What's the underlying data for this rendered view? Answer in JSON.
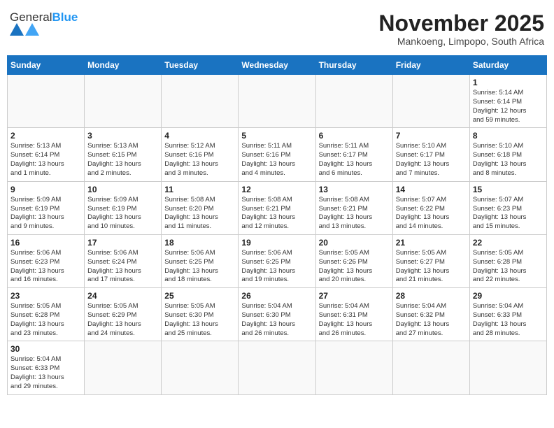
{
  "header": {
    "logo_general": "General",
    "logo_blue": "Blue",
    "month_title": "November 2025",
    "location": "Mankoeng, Limpopo, South Africa"
  },
  "weekdays": [
    "Sunday",
    "Monday",
    "Tuesday",
    "Wednesday",
    "Thursday",
    "Friday",
    "Saturday"
  ],
  "weeks": [
    [
      {
        "day": "",
        "info": ""
      },
      {
        "day": "",
        "info": ""
      },
      {
        "day": "",
        "info": ""
      },
      {
        "day": "",
        "info": ""
      },
      {
        "day": "",
        "info": ""
      },
      {
        "day": "",
        "info": ""
      },
      {
        "day": "1",
        "info": "Sunrise: 5:14 AM\nSunset: 6:14 PM\nDaylight: 12 hours\nand 59 minutes."
      }
    ],
    [
      {
        "day": "2",
        "info": "Sunrise: 5:13 AM\nSunset: 6:14 PM\nDaylight: 13 hours\nand 1 minute."
      },
      {
        "day": "3",
        "info": "Sunrise: 5:13 AM\nSunset: 6:15 PM\nDaylight: 13 hours\nand 2 minutes."
      },
      {
        "day": "4",
        "info": "Sunrise: 5:12 AM\nSunset: 6:16 PM\nDaylight: 13 hours\nand 3 minutes."
      },
      {
        "day": "5",
        "info": "Sunrise: 5:11 AM\nSunset: 6:16 PM\nDaylight: 13 hours\nand 4 minutes."
      },
      {
        "day": "6",
        "info": "Sunrise: 5:11 AM\nSunset: 6:17 PM\nDaylight: 13 hours\nand 6 minutes."
      },
      {
        "day": "7",
        "info": "Sunrise: 5:10 AM\nSunset: 6:17 PM\nDaylight: 13 hours\nand 7 minutes."
      },
      {
        "day": "8",
        "info": "Sunrise: 5:10 AM\nSunset: 6:18 PM\nDaylight: 13 hours\nand 8 minutes."
      }
    ],
    [
      {
        "day": "9",
        "info": "Sunrise: 5:09 AM\nSunset: 6:19 PM\nDaylight: 13 hours\nand 9 minutes."
      },
      {
        "day": "10",
        "info": "Sunrise: 5:09 AM\nSunset: 6:19 PM\nDaylight: 13 hours\nand 10 minutes."
      },
      {
        "day": "11",
        "info": "Sunrise: 5:08 AM\nSunset: 6:20 PM\nDaylight: 13 hours\nand 11 minutes."
      },
      {
        "day": "12",
        "info": "Sunrise: 5:08 AM\nSunset: 6:21 PM\nDaylight: 13 hours\nand 12 minutes."
      },
      {
        "day": "13",
        "info": "Sunrise: 5:08 AM\nSunset: 6:21 PM\nDaylight: 13 hours\nand 13 minutes."
      },
      {
        "day": "14",
        "info": "Sunrise: 5:07 AM\nSunset: 6:22 PM\nDaylight: 13 hours\nand 14 minutes."
      },
      {
        "day": "15",
        "info": "Sunrise: 5:07 AM\nSunset: 6:23 PM\nDaylight: 13 hours\nand 15 minutes."
      }
    ],
    [
      {
        "day": "16",
        "info": "Sunrise: 5:06 AM\nSunset: 6:23 PM\nDaylight: 13 hours\nand 16 minutes."
      },
      {
        "day": "17",
        "info": "Sunrise: 5:06 AM\nSunset: 6:24 PM\nDaylight: 13 hours\nand 17 minutes."
      },
      {
        "day": "18",
        "info": "Sunrise: 5:06 AM\nSunset: 6:25 PM\nDaylight: 13 hours\nand 18 minutes."
      },
      {
        "day": "19",
        "info": "Sunrise: 5:06 AM\nSunset: 6:25 PM\nDaylight: 13 hours\nand 19 minutes."
      },
      {
        "day": "20",
        "info": "Sunrise: 5:05 AM\nSunset: 6:26 PM\nDaylight: 13 hours\nand 20 minutes."
      },
      {
        "day": "21",
        "info": "Sunrise: 5:05 AM\nSunset: 6:27 PM\nDaylight: 13 hours\nand 21 minutes."
      },
      {
        "day": "22",
        "info": "Sunrise: 5:05 AM\nSunset: 6:28 PM\nDaylight: 13 hours\nand 22 minutes."
      }
    ],
    [
      {
        "day": "23",
        "info": "Sunrise: 5:05 AM\nSunset: 6:28 PM\nDaylight: 13 hours\nand 23 minutes."
      },
      {
        "day": "24",
        "info": "Sunrise: 5:05 AM\nSunset: 6:29 PM\nDaylight: 13 hours\nand 24 minutes."
      },
      {
        "day": "25",
        "info": "Sunrise: 5:05 AM\nSunset: 6:30 PM\nDaylight: 13 hours\nand 25 minutes."
      },
      {
        "day": "26",
        "info": "Sunrise: 5:04 AM\nSunset: 6:30 PM\nDaylight: 13 hours\nand 26 minutes."
      },
      {
        "day": "27",
        "info": "Sunrise: 5:04 AM\nSunset: 6:31 PM\nDaylight: 13 hours\nand 26 minutes."
      },
      {
        "day": "28",
        "info": "Sunrise: 5:04 AM\nSunset: 6:32 PM\nDaylight: 13 hours\nand 27 minutes."
      },
      {
        "day": "29",
        "info": "Sunrise: 5:04 AM\nSunset: 6:33 PM\nDaylight: 13 hours\nand 28 minutes."
      }
    ],
    [
      {
        "day": "30",
        "info": "Sunrise: 5:04 AM\nSunset: 6:33 PM\nDaylight: 13 hours\nand 29 minutes."
      },
      {
        "day": "",
        "info": ""
      },
      {
        "day": "",
        "info": ""
      },
      {
        "day": "",
        "info": ""
      },
      {
        "day": "",
        "info": ""
      },
      {
        "day": "",
        "info": ""
      },
      {
        "day": "",
        "info": ""
      }
    ]
  ]
}
